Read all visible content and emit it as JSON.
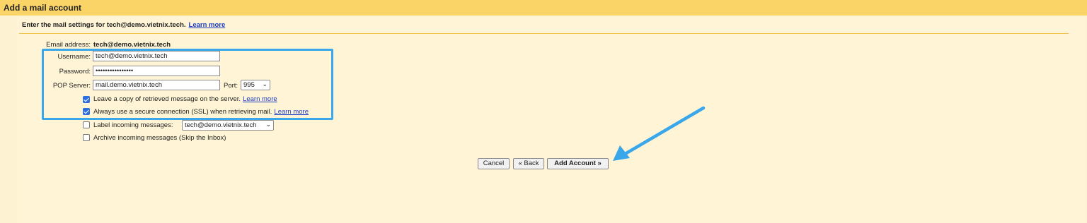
{
  "window": {
    "title": "Add a mail account"
  },
  "intro": {
    "text": "Enter the mail settings for tech@demo.vietnix.tech.",
    "link": "Learn more"
  },
  "form": {
    "email_label": "Email address:",
    "email_value": "tech@demo.vietnix.tech",
    "username_label": "Username:",
    "username_value": "tech@demo.vietnix.tech",
    "password_label": "Password:",
    "password_value": "••••••••••••••••",
    "pop_label": "POP Server:",
    "pop_value": "mail.demo.vietnix.tech",
    "port_label": "Port:",
    "port_value": "995",
    "leave_copy": {
      "text": "Leave a copy of retrieved message on the server.",
      "link": "Learn more",
      "checked": true
    },
    "ssl": {
      "text": "Always use a secure connection (SSL) when retrieving mail.",
      "link": "Learn more",
      "checked": true
    },
    "label_incoming": {
      "text": "Label incoming messages:",
      "value": "tech@demo.vietnix.tech",
      "checked": false
    },
    "archive": {
      "text": "Archive incoming messages (Skip the Inbox)",
      "checked": false
    }
  },
  "buttons": {
    "cancel": "Cancel",
    "back": "« Back",
    "add_account": "Add Account »"
  },
  "colors": {
    "title_bar": "#fbd468",
    "highlight": "#3aa7ea",
    "arrow": "#3aa7ea",
    "link": "#1a3cc4"
  }
}
